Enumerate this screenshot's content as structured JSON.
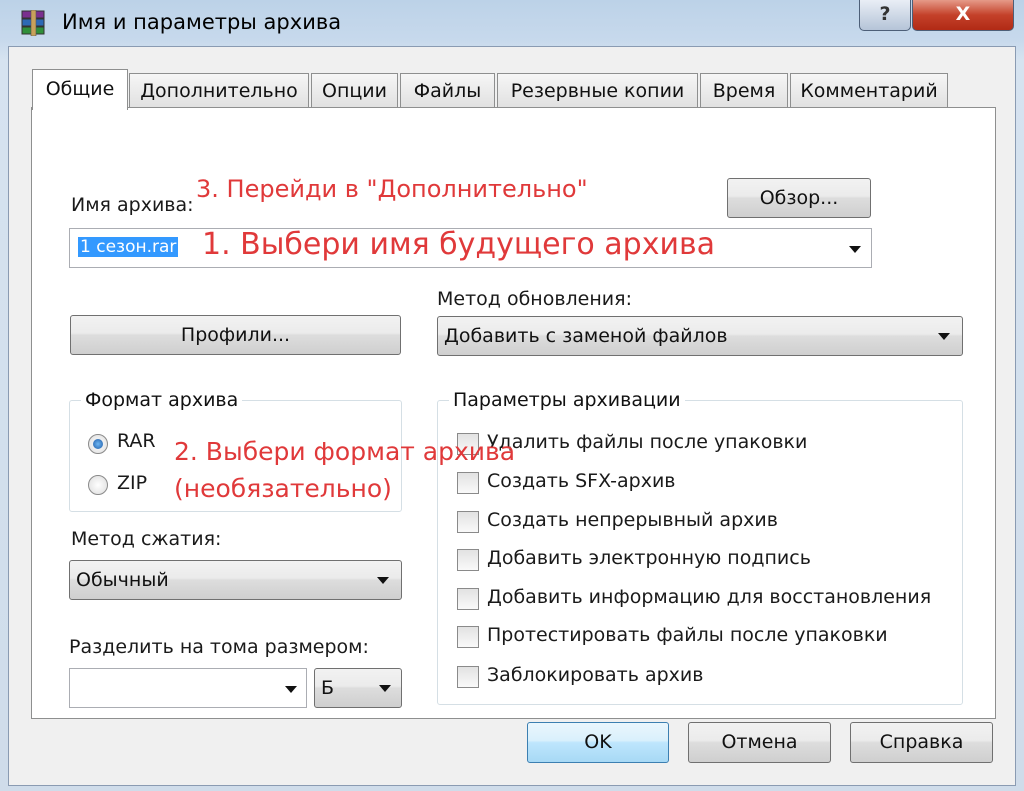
{
  "window": {
    "title": "Имя и параметры архива",
    "help_button": "?",
    "close_button": "X"
  },
  "tabs": [
    {
      "label": "Общие",
      "active": true
    },
    {
      "label": "Дополнительно"
    },
    {
      "label": "Опции"
    },
    {
      "label": "Файлы"
    },
    {
      "label": "Резервные копии"
    },
    {
      "label": "Время"
    },
    {
      "label": "Комментарий"
    }
  ],
  "general": {
    "archive_name_label": "Имя архива:",
    "archive_name_value": "1 сезон.rar",
    "browse_button": "Обзор...",
    "update_method_label": "Метод обновления:",
    "update_method_value": "Добавить с заменой файлов",
    "profiles_button": "Профили...",
    "archive_format": {
      "legend": "Формат архива",
      "options": [
        {
          "label": "RAR",
          "selected": true
        },
        {
          "label": "ZIP",
          "selected": false
        }
      ]
    },
    "compression_label": "Метод сжатия:",
    "compression_value": "Обычный",
    "split_label": "Разделить на тома размером:",
    "split_value": "",
    "split_unit": "Б",
    "archive_options": {
      "legend": "Параметры архивации",
      "items": [
        {
          "label": "Удалить файлы после упаковки",
          "checked": false
        },
        {
          "label": "Создать SFX-архив",
          "checked": false
        },
        {
          "label": "Создать непрерывный архив",
          "checked": false
        },
        {
          "label": "Добавить электронную подпись",
          "checked": false
        },
        {
          "label": "Добавить информацию для восстановления",
          "checked": false
        },
        {
          "label": "Протестировать файлы после упаковки",
          "checked": false
        },
        {
          "label": "Заблокировать архив",
          "checked": false
        }
      ]
    }
  },
  "footer": {
    "ok": "OK",
    "cancel": "Отмена",
    "help": "Справка"
  },
  "annotations": {
    "step1": "1. Выбери имя будущего архива",
    "step2_line1": "2. Выбери формат архива",
    "step2_line2": "(необязательно)",
    "step3": "3. Перейди в \"Дополнительно\""
  },
  "colors": {
    "annotation": "#e0393a",
    "selection": "#3399ff",
    "close_button": "#c4412a"
  }
}
